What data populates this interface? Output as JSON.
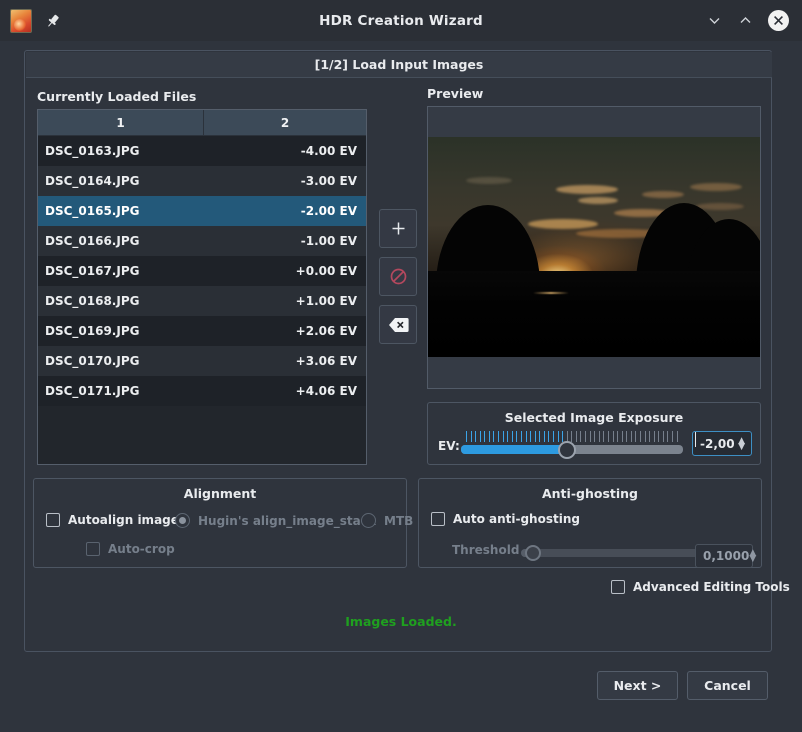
{
  "window": {
    "title": "HDR Creation Wizard",
    "app_icon": "luminance-hdr-icon",
    "pin_icon": "pin-icon",
    "minimize_icon": "chevron-down-icon",
    "maximize_icon": "chevron-up-icon",
    "close_icon": "close-icon"
  },
  "step_header": "[1/2] Load Input Images",
  "files_section": {
    "label": "Currently Loaded Files",
    "columns": [
      "1",
      "2"
    ],
    "rows": [
      {
        "name": "DSC_0163.JPG",
        "ev": "-4.00 EV",
        "selected": false
      },
      {
        "name": "DSC_0164.JPG",
        "ev": "-3.00 EV",
        "selected": false
      },
      {
        "name": "DSC_0165.JPG",
        "ev": "-2.00 EV",
        "selected": true
      },
      {
        "name": "DSC_0166.JPG",
        "ev": "-1.00 EV",
        "selected": false
      },
      {
        "name": "DSC_0167.JPG",
        "ev": "+0.00 EV",
        "selected": false
      },
      {
        "name": "DSC_0168.JPG",
        "ev": "+1.00 EV",
        "selected": false
      },
      {
        "name": "DSC_0169.JPG",
        "ev": "+2.06 EV",
        "selected": false
      },
      {
        "name": "DSC_0170.JPG",
        "ev": "+3.06 EV",
        "selected": false
      },
      {
        "name": "DSC_0171.JPG",
        "ev": "+4.06 EV",
        "selected": false
      }
    ]
  },
  "tool_buttons": [
    {
      "name": "add-images-button",
      "icon": "plus-icon",
      "glyph": "+"
    },
    {
      "name": "remove-image-button",
      "icon": "no-entry-icon",
      "glyph": ""
    },
    {
      "name": "clear-list-button",
      "icon": "backspace-icon",
      "glyph": ""
    }
  ],
  "preview": {
    "label": "Preview"
  },
  "exposure": {
    "title": "Selected Image Exposure",
    "ev_label": "EV:",
    "value": "-2,00",
    "slider_percent": 46,
    "up_arrow": "▲",
    "down_arrow": "▼"
  },
  "alignment": {
    "title": "Alignment",
    "autoalign_label": "Autoalign images",
    "autoalign_checked": false,
    "hugin_label": "Hugin's align_image_stack",
    "hugin_selected": true,
    "mtb_label": "MTB",
    "mtb_selected": false,
    "autocrop_label": "Auto-crop",
    "autocrop_checked": false
  },
  "antighosting": {
    "title": "Anti-ghosting",
    "auto_label": "Auto anti-ghosting",
    "auto_checked": false,
    "threshold_label": "Threshold",
    "threshold_value": "0,1000",
    "threshold_percent": 8,
    "up_arrow": "▲",
    "down_arrow": "▼"
  },
  "advanced": {
    "label": "Advanced Editing Tools",
    "checked": false
  },
  "status": {
    "text": "Images Loaded.",
    "color": "#1fa01f"
  },
  "footer": {
    "next_label": "Next >",
    "cancel_label": "Cancel"
  }
}
